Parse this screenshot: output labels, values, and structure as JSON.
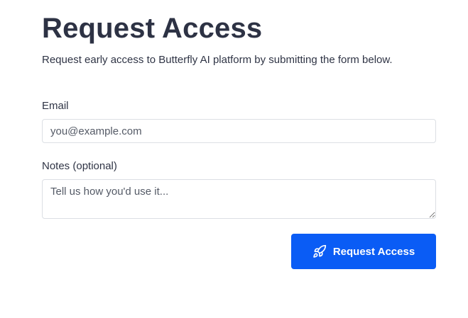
{
  "header": {
    "title": "Request Access",
    "subtitle": "Request early access to Butterfly AI platform by submitting the form below."
  },
  "form": {
    "email_label": "Email",
    "email_placeholder": "you@example.com",
    "email_value": "",
    "notes_label": "Notes (optional)",
    "notes_placeholder": "Tell us how you'd use it...",
    "notes_value": "",
    "submit_label": "Request Access",
    "submit_icon": "rocket-icon",
    "accent_color": "#0a5cf5"
  }
}
